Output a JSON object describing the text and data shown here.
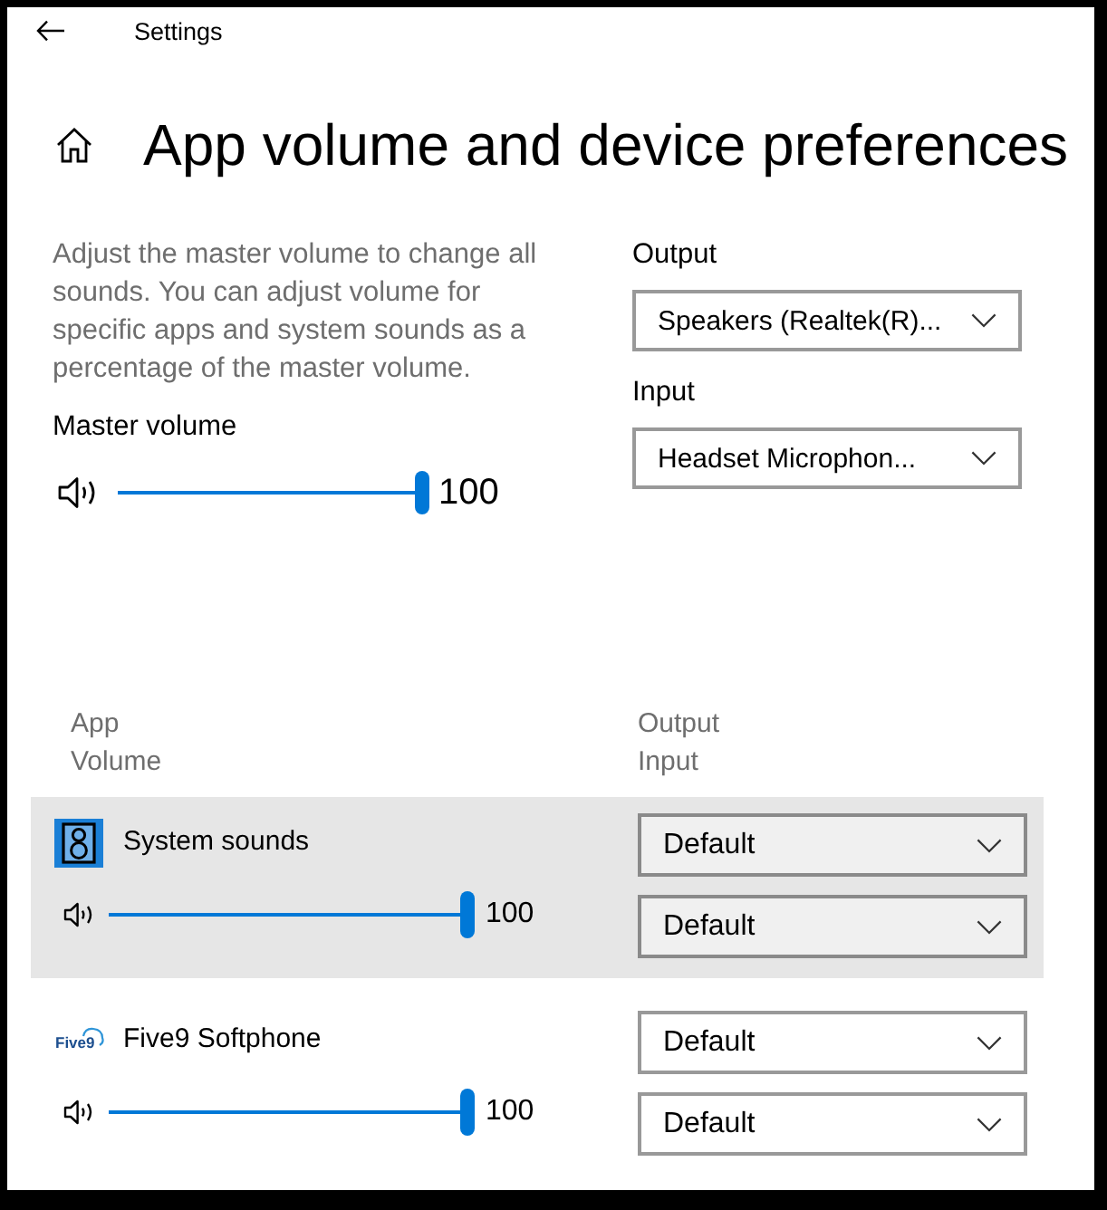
{
  "window": {
    "title": "Settings"
  },
  "page": {
    "title": "App volume and device preferences"
  },
  "master": {
    "description": "Adjust the master volume to change all sounds. You can adjust volume for specific apps and system sounds as a percentage of the master volume.",
    "label": "Master volume",
    "level": 1,
    "reading": "100"
  },
  "devices": [
    {
      "label": "Output",
      "value": "Speakers (Realtek(R)..."
    },
    {
      "label": "Input",
      "value": "Headset Microphon..."
    }
  ],
  "headers": {
    "app": "App",
    "volume": "Volume",
    "output": "Output",
    "input": "Input"
  },
  "apps": [
    {
      "kind": "system",
      "name": "System sounds",
      "selected": true,
      "level": 1,
      "reading": "100",
      "output": "Default",
      "input": "Default"
    },
    {
      "kind": "logo",
      "logo_text": "Five9",
      "name": "Five9 Softphone",
      "selected": false,
      "level": 1,
      "reading": "100",
      "output": "Default",
      "input": "Default"
    }
  ]
}
